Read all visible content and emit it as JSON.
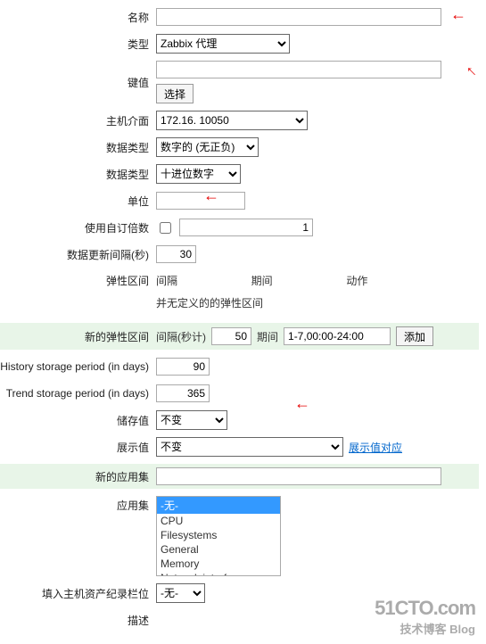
{
  "labels": {
    "name": "名称",
    "type": "类型",
    "key": "键值",
    "host_interface": "主机介面",
    "data_type": "数据类型",
    "number_type": "数据类型",
    "unit": "单位",
    "custom_multiplier": "使用自订倍数",
    "update_interval": "数据更新间隔(秒)",
    "flexible_intervals": "弹性区间",
    "new_flexible": "新的弹性区间",
    "history": "History storage period (in days)",
    "trend": "Trend storage period (in days)",
    "store_value": "储存值",
    "show_value": "展示值",
    "new_app": "新的应用集",
    "applications": "应用集",
    "inventory": "填入主机资产纪录栏位",
    "description": "描述"
  },
  "values": {
    "name": "",
    "type": "Zabbix 代理",
    "key": "",
    "host_interface_ip": "172.16.",
    "host_interface_port": "10050",
    "data_type": "数字的 (无正负)",
    "number_type": "十进位数字",
    "unit": "",
    "custom_multiplier_value": "1",
    "update_interval": "30",
    "new_interval": "50",
    "new_period": "1-7,00:00-24:00",
    "history": "90",
    "trend": "365",
    "store_value": "不变",
    "show_value": "不变",
    "new_app": "",
    "inventory": "-无-"
  },
  "flex_table": {
    "h1": "间隔",
    "h2": "期间",
    "h3": "动作",
    "empty": "并无定义的的弹性区间"
  },
  "new_flex_labels": {
    "interval": "间隔(秒计)",
    "period": "期间"
  },
  "buttons": {
    "select": "选择",
    "add": "添加"
  },
  "links": {
    "show_value_map": "展示值对应"
  },
  "applications": {
    "options": [
      "-无-",
      "CPU",
      "Filesystems",
      "General",
      "Memory",
      "Network interfaces"
    ],
    "selected_index": 0
  },
  "watermark": {
    "line1": "51CTO.com",
    "line2": "技术博客  Blog"
  }
}
